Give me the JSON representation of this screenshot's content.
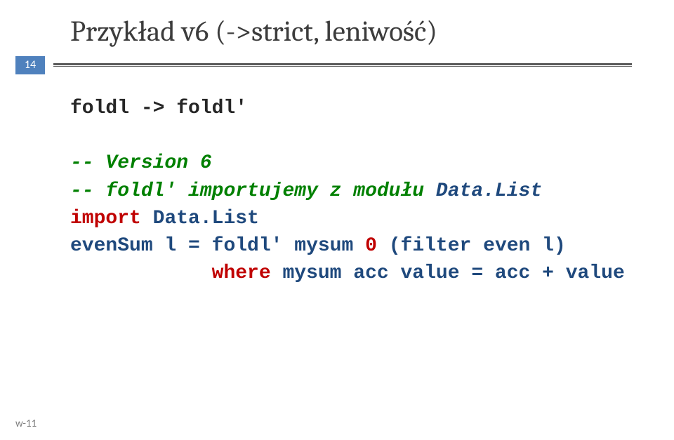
{
  "title": "Przykład v6 (->strict, leniwość)",
  "page_number": "14",
  "code": {
    "blank1": "",
    "line1": "foldl -> foldl'",
    "blank2": "",
    "comment1_a": "-- Version 6",
    "comment2_a": "-- foldl'",
    "comment2_b": " importujemy z modułu ",
    "comment2_c": "Data.List",
    "import_kw": "import",
    "import_sp": " ",
    "import_mod": "Data.List",
    "def_a": "evenSum l = ",
    "def_b": "foldl'",
    "def_c": " mysum ",
    "def_d": "0",
    "def_e": " (",
    "def_f": "filter",
    "def_g": " even l)",
    "where_indent": "            ",
    "where_kw": "where",
    "where_sp": " ",
    "where_rest": "mysum acc value = acc + value"
  },
  "footer": "w-11"
}
